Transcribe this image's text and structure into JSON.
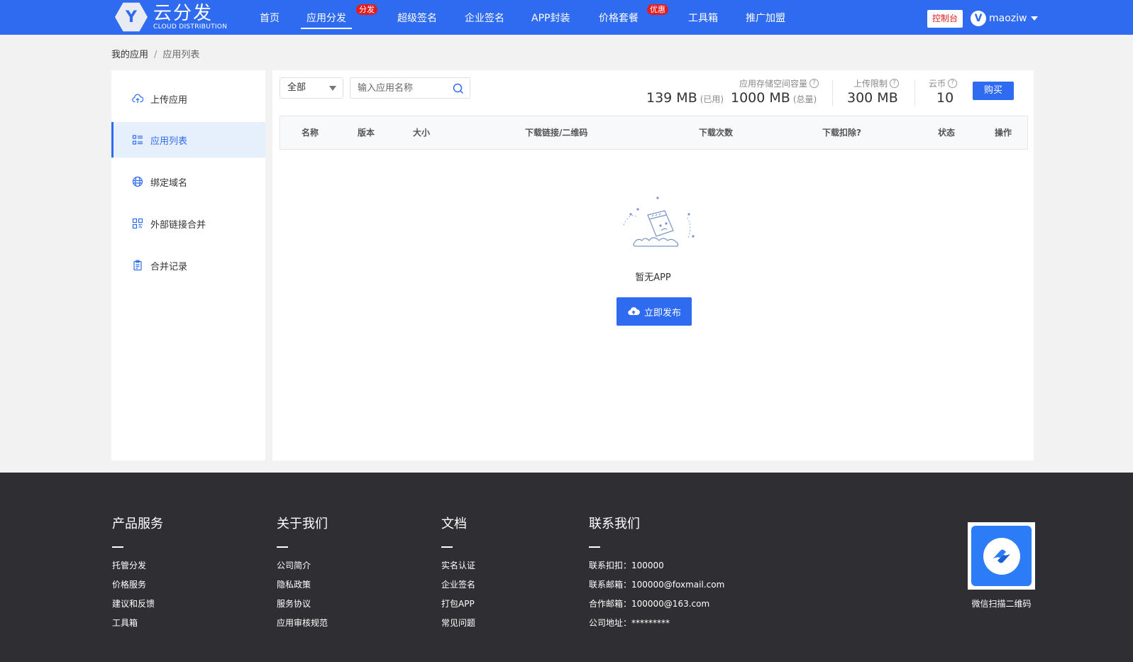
{
  "header": {
    "logo_letter": "Y",
    "logo_cn": "云分发",
    "logo_en": "CLOUD DISTRIBUTION",
    "nav": [
      {
        "label": "首页"
      },
      {
        "label": "应用分发",
        "badge": "分发"
      },
      {
        "label": "超级签名"
      },
      {
        "label": "企业签名"
      },
      {
        "label": "APP封装"
      },
      {
        "label": "价格套餐",
        "badge": "优惠"
      },
      {
        "label": "工具箱"
      },
      {
        "label": "推广加盟"
      }
    ],
    "console_label": "控制台",
    "avatar_letter": "V",
    "username": "maoziw"
  },
  "breadcrumb": {
    "parent": "我的应用",
    "separator": "/",
    "current": "应用列表"
  },
  "sidebar": {
    "items": [
      {
        "label": "上传应用",
        "icon": "cloud-upload-icon"
      },
      {
        "label": "应用列表",
        "icon": "list-icon"
      },
      {
        "label": "绑定域名",
        "icon": "globe-icon"
      },
      {
        "label": "外部链接合并",
        "icon": "qrcode-icon"
      },
      {
        "label": "合并记录",
        "icon": "clipboard-icon"
      }
    ]
  },
  "toolbar": {
    "filter_value": "全部",
    "search_placeholder": "输入应用名称",
    "storage_label": "应用存储空间容量",
    "used_value": "139 MB",
    "used_note": "(已用)",
    "total_value": "1000 MB",
    "total_note": "(总量)",
    "upload_limit_label": "上传限制",
    "upload_limit_value": "300 MB",
    "coins_label": "云币",
    "coins_value": "10",
    "help_mark": "?",
    "buy_label": "购买"
  },
  "table": {
    "columns": [
      "名称",
      "版本",
      "大小",
      "下载链接/二维码",
      "下载次数",
      "下载扣除?",
      "状态",
      "操作"
    ],
    "rows": []
  },
  "empty": {
    "text": "暂无APP",
    "publish_label": "立即发布"
  },
  "footer": {
    "columns": [
      {
        "title": "产品服务",
        "links": [
          "托管分发",
          "价格服务",
          "建议和反馈",
          "工具箱"
        ]
      },
      {
        "title": "关于我们",
        "links": [
          "公司简介",
          "隐私政策",
          "服务协议",
          "应用审核规范"
        ]
      },
      {
        "title": "文档",
        "links": [
          "实名认证",
          "企业签名",
          "打包APP",
          "常见问题"
        ]
      },
      {
        "title": "联系我们",
        "links": [
          "联系扣扣：100000",
          "联系邮箱：100000@foxmail.com",
          "合作邮箱：100000@163.com",
          "公司地址：*********"
        ]
      }
    ],
    "qr_caption": "微信扫描二维码"
  },
  "colors": {
    "primary": "#2f6bf0",
    "badge_red": "#e31d1d",
    "footer_bg": "#2f2f33"
  }
}
